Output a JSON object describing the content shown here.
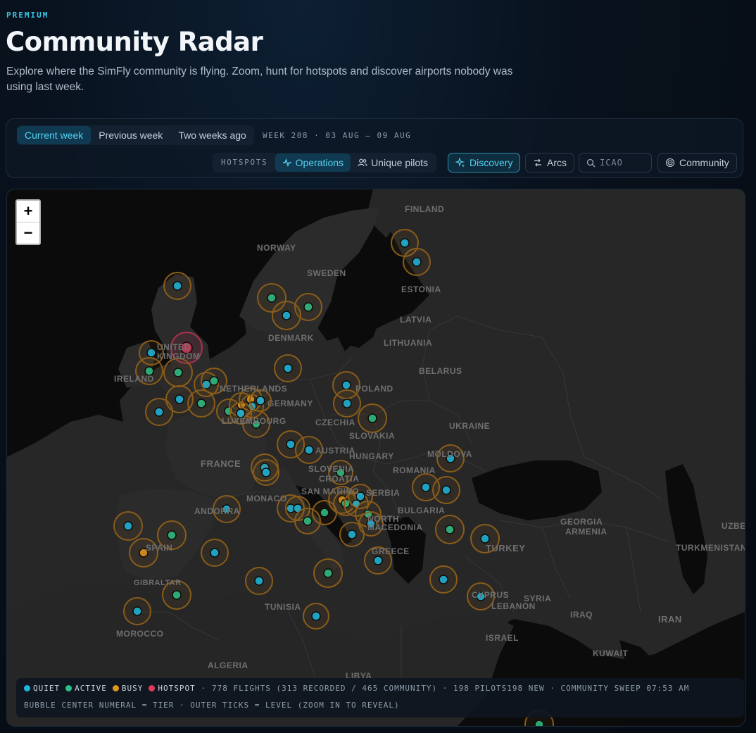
{
  "header": {
    "eyebrow": "PREMIUM",
    "title": "Community Radar",
    "description": "Explore where the SimFly community is flying. Zoom, hunt for hotspots and discover airports nobody was using last week."
  },
  "week_tabs": [
    "Current week",
    "Previous week",
    "Two weeks ago"
  ],
  "week_label": "WEEK 208 · 03 AUG – 09 AUG",
  "hotspots": {
    "label": "HOTSPOTS",
    "options": [
      "Operations",
      "Unique pilots"
    ],
    "selected": "Operations"
  },
  "buttons": {
    "discovery": "Discovery",
    "arcs": "Arcs",
    "community": "Community"
  },
  "search": {
    "placeholder": "ICAO"
  },
  "map": {
    "zoom_in": "+",
    "zoom_out": "−",
    "countries": [
      "FINLAND",
      "NORWAY",
      "SWEDEN",
      "ESTONIA",
      "LATVIA",
      "DENMARK",
      "LITHUANIA",
      "UNITED KINGDOM",
      "IRELAND",
      "BELARUS",
      "NETHERLANDS",
      "POLAND",
      "GERMANY",
      "LUXEMBOURG",
      "CZECHIA",
      "UKRAINE",
      "SLOVAKIA",
      "FRANCE",
      "AUSTRIA",
      "HUNGARY",
      "MOLDOVA",
      "SLOVENIA",
      "CROATIA",
      "ROMANIA",
      "SAN MARINO",
      "MONACO",
      "ANDORRA",
      "SERBIA",
      "BULGARIA",
      "NORTH MACEDONIA",
      "GEORGIA",
      "ARMENIA",
      "UZBE",
      "SPAIN",
      "GREECE",
      "TURKEY",
      "TURKMENISTAN",
      "GIBRALTAR",
      "SYRIA",
      "LEBANON",
      "CYPRUS",
      "TUNISIA",
      "IRAQ",
      "IRAN",
      "MOROCCO",
      "ISRAEL",
      "KUWAIT",
      "ALGERIA",
      "LIBYA"
    ]
  },
  "legend": {
    "statuses": [
      {
        "label": "QUIET",
        "color": "#1fb6dc"
      },
      {
        "label": "ACTIVE",
        "color": "#2fbf84"
      },
      {
        "label": "BUSY",
        "color": "#e0961c"
      },
      {
        "label": "HOTSPOT",
        "color": "#e03a58"
      }
    ],
    "stats": "· 778 FLIGHTS (313 RECORDED / 465 COMMUNITY) · 198 PILOTS198 NEW · COMMUNITY SWEEP 07:53 AM",
    "note": "BUBBLE CENTER NUMERAL = TIER · OUTER TICKS = LEVEL (ZOOM IN TO REVEAL)"
  },
  "colors": {
    "accent": "#38c6e6",
    "ring": "#b8791c",
    "land": "#2a2a2a",
    "sea": "#0b0b0b"
  }
}
